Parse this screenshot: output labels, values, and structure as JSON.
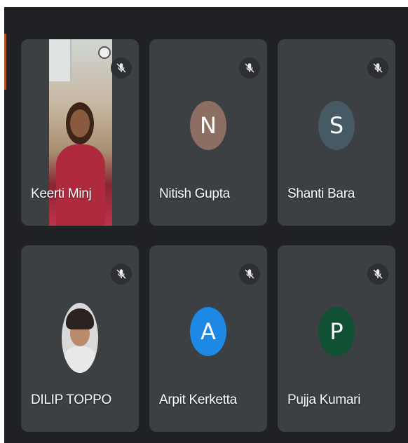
{
  "participants": [
    {
      "name": "Keerti Minj",
      "type": "video",
      "muted": true
    },
    {
      "name": "Nitish Gupta",
      "type": "initial",
      "initial": "N",
      "color": "#8d6e63",
      "muted": true
    },
    {
      "name": "Shanti Bara",
      "type": "initial",
      "initial": "S",
      "color": "#455a64",
      "muted": true
    },
    {
      "name": "DILIP TOPPO",
      "type": "photo",
      "muted": true
    },
    {
      "name": "Arpit Kerketta",
      "type": "initial",
      "initial": "A",
      "color": "#1e88e5",
      "muted": true
    },
    {
      "name": "Pujja Kumari",
      "type": "initial",
      "initial": "P",
      "color": "#0f5132",
      "muted": true
    }
  ],
  "colors": {
    "background": "#202124",
    "tile": "#3c4043",
    "mic_badge": "#2d2f31"
  },
  "icons": {
    "mic": "mic-off-icon"
  }
}
